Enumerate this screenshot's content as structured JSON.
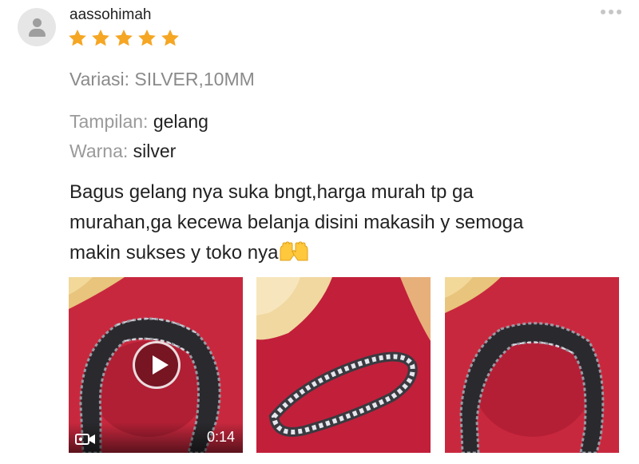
{
  "review": {
    "username": "aassohimah",
    "rating": 5,
    "max_rating": 5,
    "star_color": "#f5a623",
    "variation": "Variasi: SILVER,10MM",
    "attributes": [
      {
        "label": "Tampilan: ",
        "value": "gelang"
      },
      {
        "label": "Warna: ",
        "value": "silver"
      }
    ],
    "text": "Bagus gelang nya suka bngt,harga murah tp ga\nmurahan,ga kecewa belanja disini makasih y semoga\nmakin sukses y toko nya",
    "text_emoji": "raised-hands-emoji",
    "more_icon": "more-options-icon",
    "media": [
      {
        "type": "video",
        "duration": "0:14",
        "icon": "video-camera-icon"
      },
      {
        "type": "image"
      },
      {
        "type": "image"
      }
    ]
  }
}
